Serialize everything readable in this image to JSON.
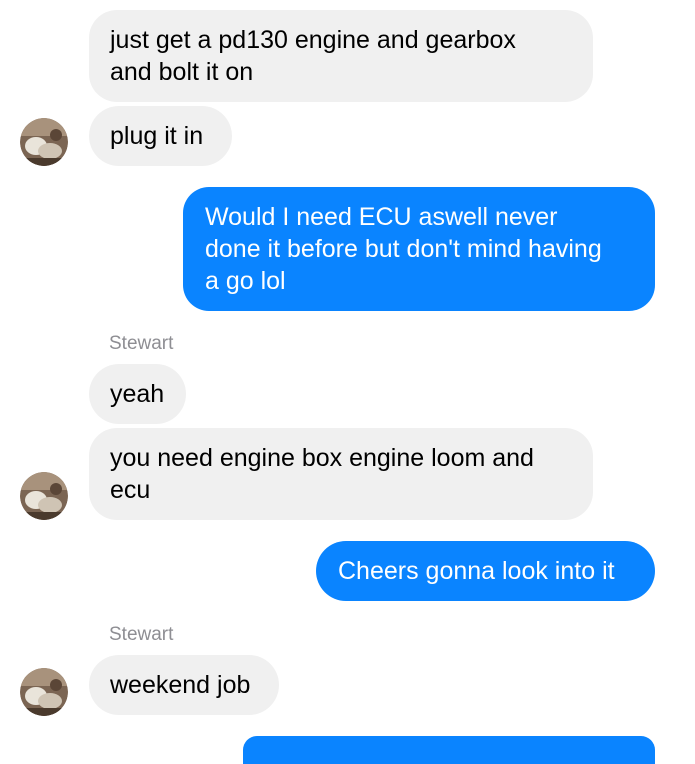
{
  "conversation": {
    "messages": [
      {
        "direction": "incoming",
        "text": "just get a pd130 engine and gearbox\nand bolt it on"
      },
      {
        "direction": "incoming",
        "text": "plug it in"
      },
      {
        "direction": "outgoing",
        "text": "Would I need ECU aswell never\ndone it before but don't mind having\na go lol"
      },
      {
        "direction": "incoming",
        "sender": "Stewart",
        "text": "yeah"
      },
      {
        "direction": "incoming",
        "text": "you need engine box engine loom and\necu"
      },
      {
        "direction": "outgoing",
        "text": "Cheers gonna look into it"
      },
      {
        "direction": "incoming",
        "sender": "Stewart",
        "text": "weekend job"
      },
      {
        "direction": "outgoing",
        "text": ""
      }
    ]
  },
  "colors": {
    "outgoing_bubble": "#0a84ff",
    "incoming_bubble": "#f0f0f0",
    "sender_name": "#8e8e93"
  },
  "icons": {
    "avatar": "avatar-photo-icon"
  }
}
